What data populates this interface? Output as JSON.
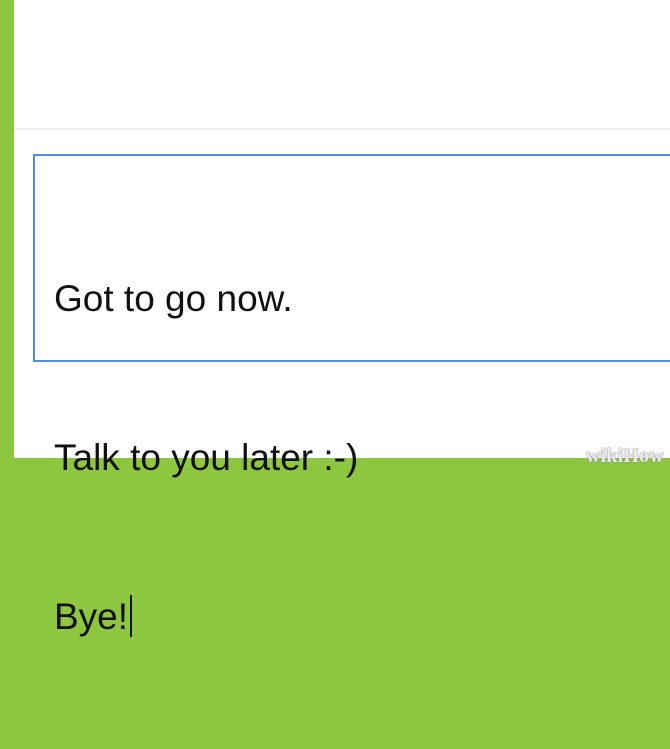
{
  "composer": {
    "lines": [
      "Got to go now.",
      "Talk to you later :-)",
      "Bye!"
    ]
  },
  "watermark": {
    "text": "wikiHow"
  },
  "colors": {
    "frame_green": "#8dc63f",
    "input_border_blue": "#4f8ee6",
    "text": "#111111"
  }
}
